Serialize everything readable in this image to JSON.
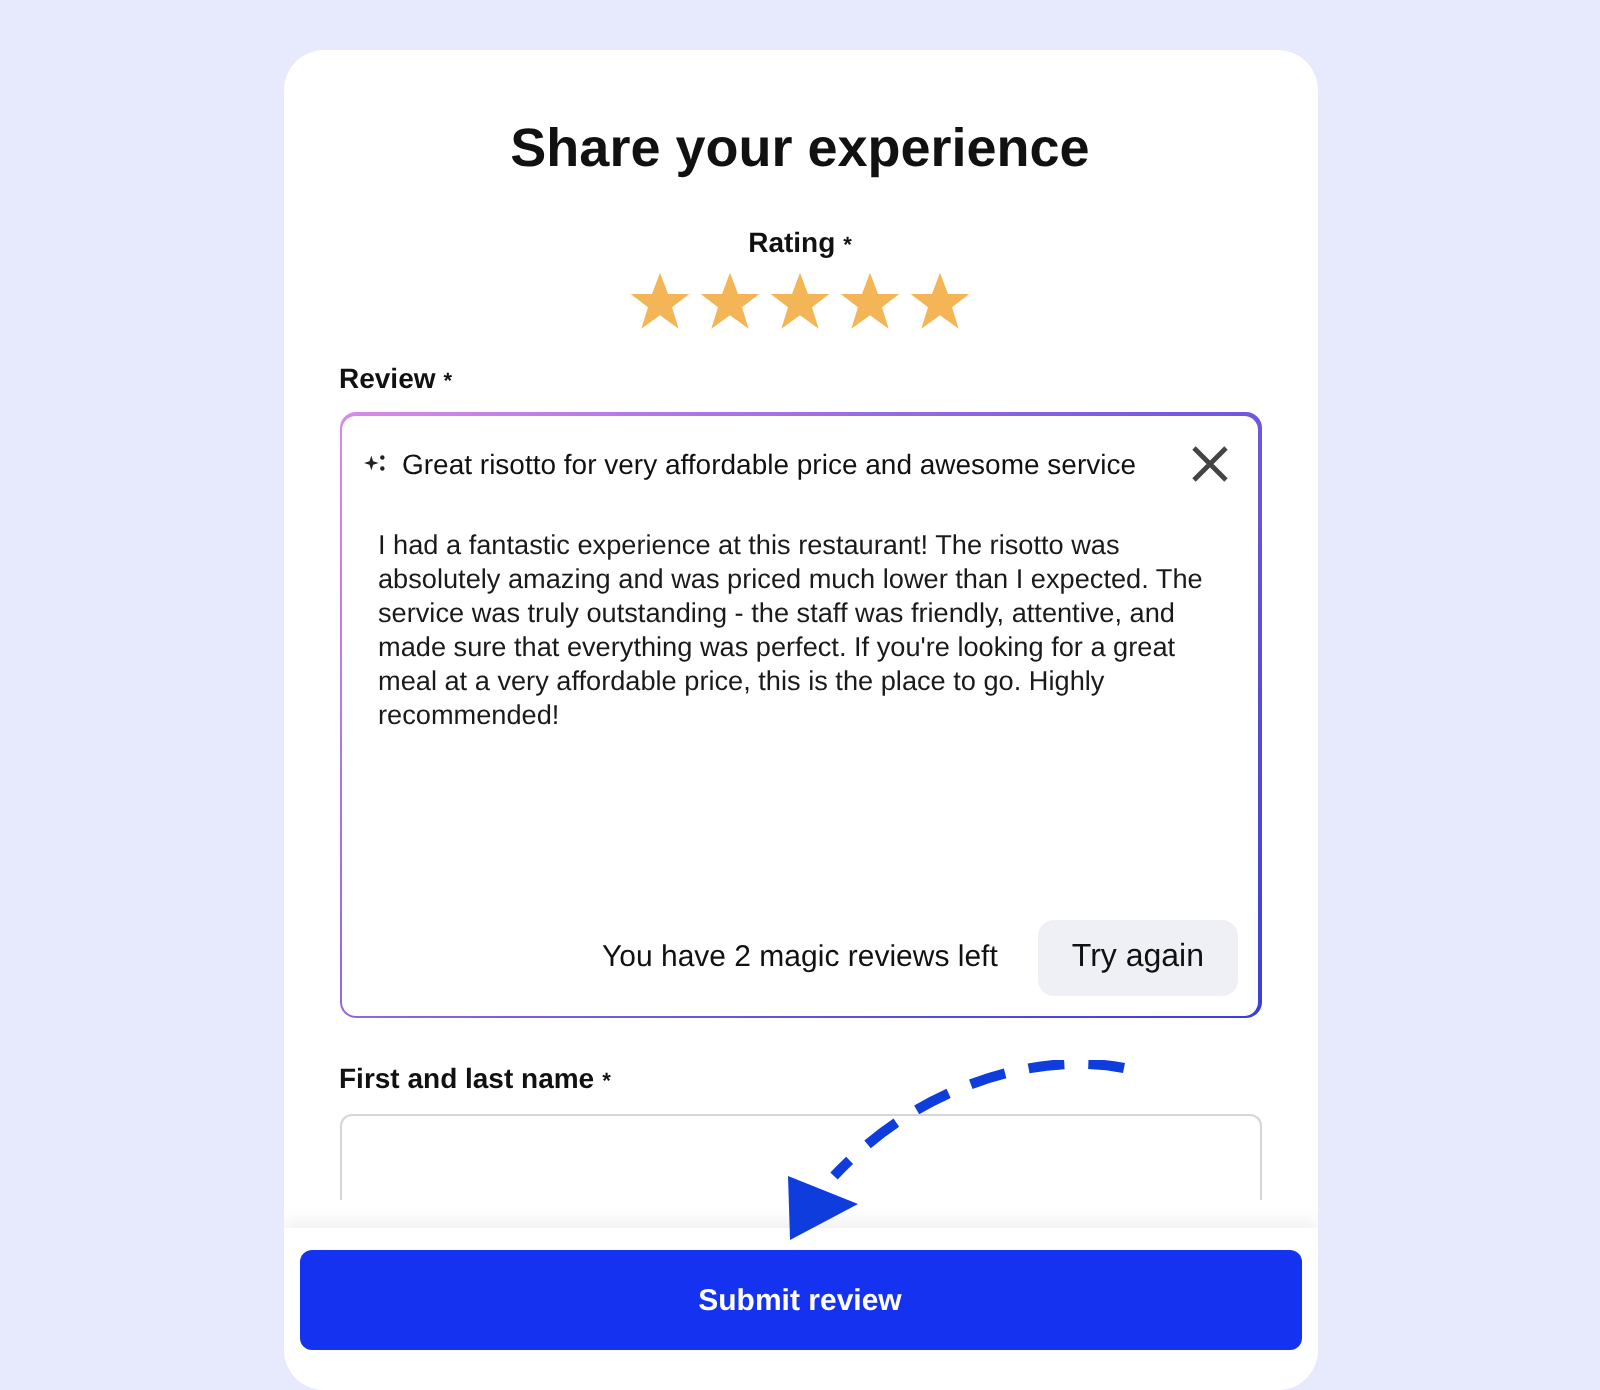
{
  "title": "Share your experience",
  "rating": {
    "label": "Rating",
    "required_mark": "*",
    "stars": 5
  },
  "review": {
    "label": "Review",
    "required_mark": "*",
    "suggestion": "Great risotto for very affordable price and awesome service",
    "value": "I had a fantastic experience at this restaurant! The risotto was absolutely amazing and was priced much lower than I expected. The service was truly outstanding - the staff was friendly, attentive, and made sure that everything was perfect. If you're looking for a great meal at a very affordable price, this is the place to go. Highly recommended!",
    "remaining": "You have 2 magic reviews left",
    "retry_button": "Try again"
  },
  "name_field": {
    "label": "First and last name",
    "required_mark": "*"
  },
  "submit_button": "Submit review"
}
